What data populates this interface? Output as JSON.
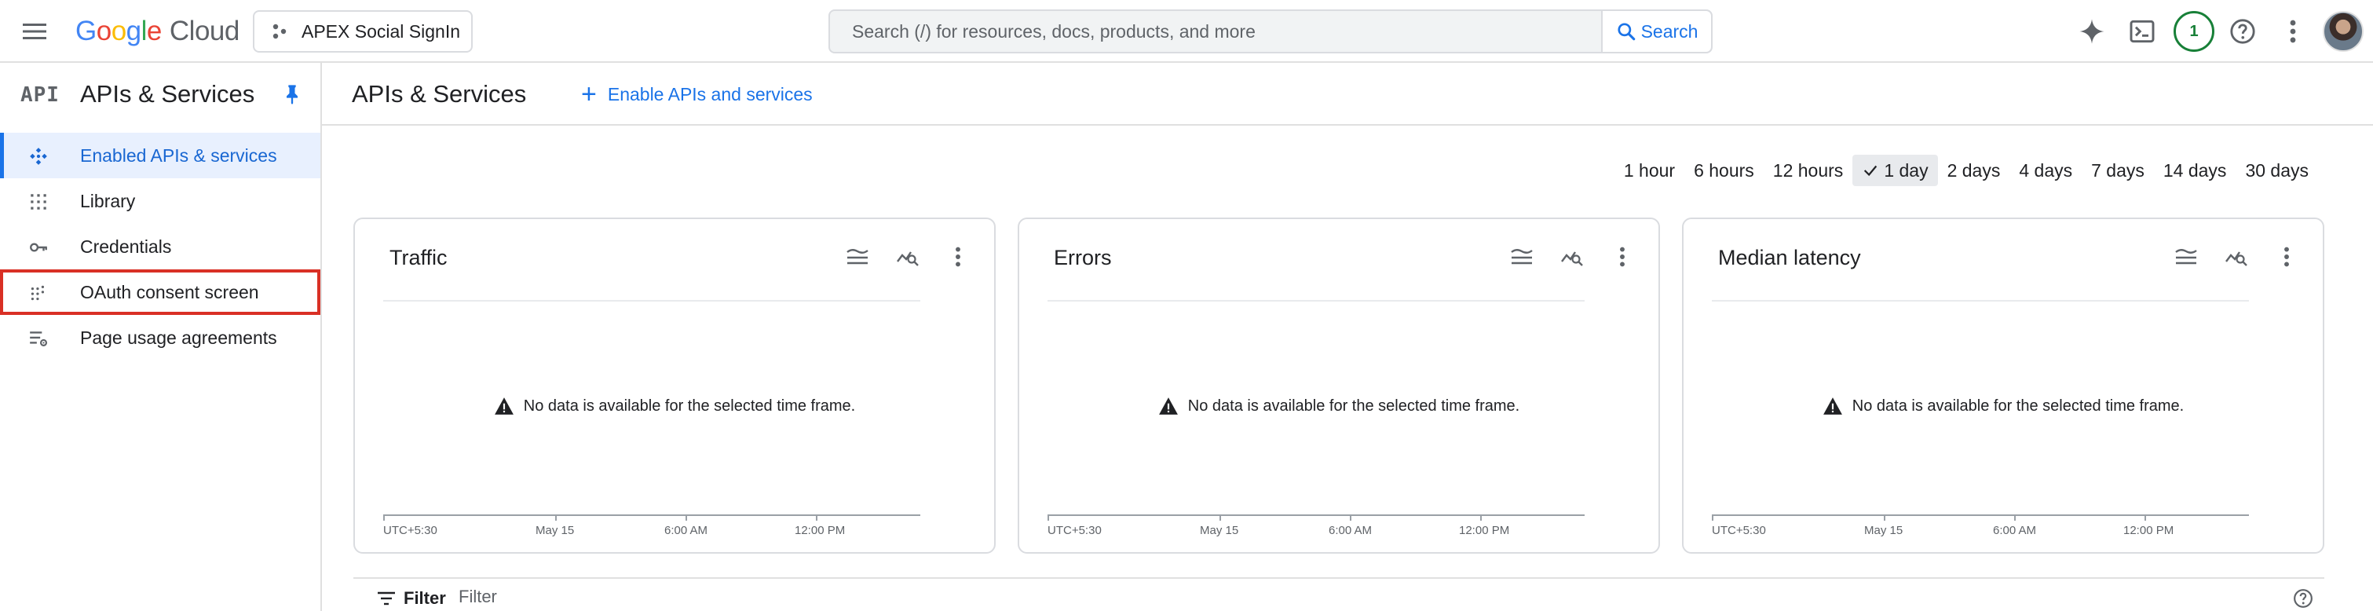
{
  "topbar": {
    "logo_google": "Google",
    "logo_cloud": "Cloud",
    "project_name": "APEX Social SignIn",
    "search_placeholder": "Search (/) for resources, docs, products, and more",
    "search_button": "Search",
    "notification_count": "1",
    "icons": [
      "menu-icon",
      "gemini-sparkle-icon",
      "cloud-shell-icon",
      "help-icon",
      "more-vert-icon",
      "account-avatar"
    ]
  },
  "sidebar": {
    "logo_text": "API",
    "title": "APIs & Services",
    "items": [
      {
        "label": "Enabled APIs & services",
        "icon": "hub-icon",
        "active": true
      },
      {
        "label": "Library",
        "icon": "library-icon"
      },
      {
        "label": "Credentials",
        "icon": "key-icon"
      },
      {
        "label": "OAuth consent screen",
        "icon": "consent-icon",
        "highlighted": true
      },
      {
        "label": "Page usage agreements",
        "icon": "settings-list-icon"
      }
    ],
    "accent_color": "#1a73e8",
    "highlight_color": "#d93025"
  },
  "main": {
    "title": "APIs & Services",
    "enable_button": "Enable APIs and services",
    "time_ranges": [
      "1 hour",
      "6 hours",
      "12 hours",
      "1 day",
      "2 days",
      "4 days",
      "7 days",
      "14 days",
      "30 days"
    ],
    "selected_time_range": "1 day",
    "cards": [
      {
        "title": "Traffic",
        "message": "No data is available for the selected time frame.",
        "axis_labels": [
          "UTC+5:30",
          "May 15",
          "6:00 AM",
          "12:00 PM"
        ]
      },
      {
        "title": "Errors",
        "message": "No data is available for the selected time frame.",
        "axis_labels": [
          "UTC+5:30",
          "May 15",
          "6:00 AM",
          "12:00 PM"
        ]
      },
      {
        "title": "Median latency",
        "message": "No data is available for the selected time frame.",
        "axis_labels": [
          "UTC+5:30",
          "May 15",
          "6:00 AM",
          "12:00 PM"
        ]
      }
    ],
    "filter_label": "Filter",
    "filter_placeholder": "Filter"
  }
}
